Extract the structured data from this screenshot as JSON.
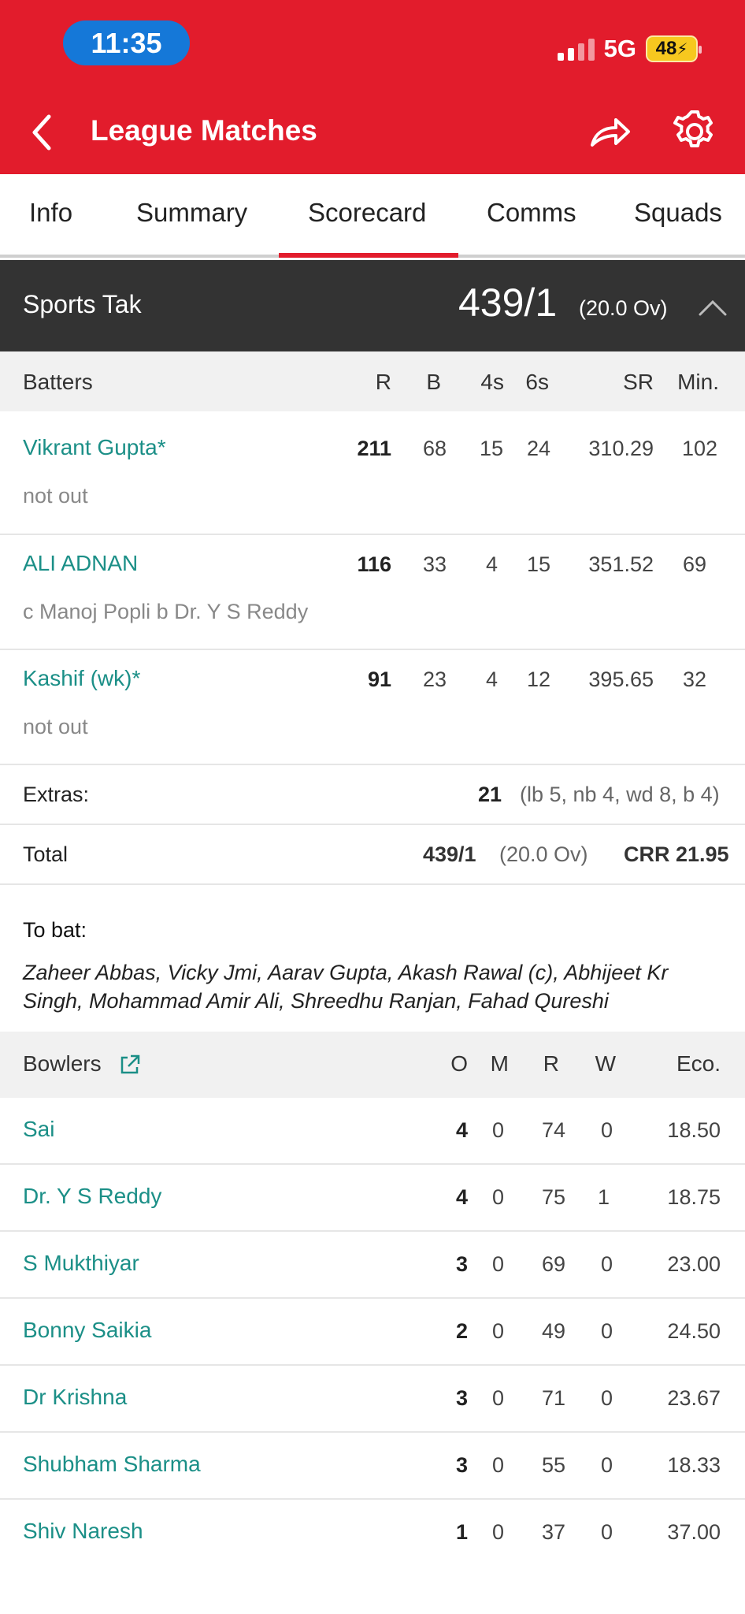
{
  "status_bar": {
    "time": "11:35",
    "network": "5G",
    "battery": "48"
  },
  "header": {
    "title": "League Matches"
  },
  "tabs": [
    "Info",
    "Summary",
    "Scorecard",
    "Comms",
    "Squads"
  ],
  "active_tab": "Scorecard",
  "innings": {
    "team": "Sports Tak",
    "score": "439/1",
    "overs": "(20.0 Ov)"
  },
  "batting": {
    "headers": {
      "name": "Batters",
      "r": "R",
      "b": "B",
      "fours": "4s",
      "sixes": "6s",
      "sr": "SR",
      "min": "Min."
    },
    "rows": [
      {
        "name": "Vikrant Gupta*",
        "dismissal": "not out",
        "r": "211",
        "b": "68",
        "fours": "15",
        "sixes": "24",
        "sr": "310.29",
        "min": "102"
      },
      {
        "name": "ALI ADNAN",
        "dismissal": "c Manoj Popli b Dr. Y S Reddy",
        "r": "116",
        "b": "33",
        "fours": "4",
        "sixes": "15",
        "sr": "351.52",
        "min": "69"
      },
      {
        "name": "Kashif  (wk)*",
        "dismissal": "not out",
        "r": "91",
        "b": "23",
        "fours": "4",
        "sixes": "12",
        "sr": "395.65",
        "min": "32"
      }
    ],
    "extras": {
      "label": "Extras:",
      "value": "21",
      "detail": "(lb 5, nb 4, wd 8, b 4)"
    },
    "total": {
      "label": "Total",
      "score": "439/1",
      "overs": "(20.0 Ov)",
      "crr": "CRR 21.95"
    },
    "to_bat": {
      "label": "To bat:",
      "players": "Zaheer Abbas, Vicky Jmi, Aarav Gupta, Akash Rawal (c), Abhijeet Kr Singh, Mohammad Amir Ali, Shreedhu Ranjan, Fahad Qureshi"
    }
  },
  "bowling": {
    "headers": {
      "name": "Bowlers",
      "o": "O",
      "m": "M",
      "r": "R",
      "w": "W",
      "eco": "Eco."
    },
    "rows": [
      {
        "name": "Sai",
        "o": "4",
        "m": "0",
        "r": "74",
        "w": "0",
        "eco": "18.50"
      },
      {
        "name": "Dr. Y S Reddy",
        "o": "4",
        "m": "0",
        "r": "75",
        "w": "1",
        "eco": "18.75"
      },
      {
        "name": "S Mukthiyar",
        "o": "3",
        "m": "0",
        "r": "69",
        "w": "0",
        "eco": "23.00"
      },
      {
        "name": "Bonny Saikia",
        "o": "2",
        "m": "0",
        "r": "49",
        "w": "0",
        "eco": "24.50"
      },
      {
        "name": "Dr Krishna",
        "o": "3",
        "m": "0",
        "r": "71",
        "w": "0",
        "eco": "23.67"
      },
      {
        "name": "Shubham Sharma",
        "o": "3",
        "m": "0",
        "r": "55",
        "w": "0",
        "eco": "18.33"
      },
      {
        "name": "Shiv Naresh",
        "o": "1",
        "m": "0",
        "r": "37",
        "w": "0",
        "eco": "37.00"
      }
    ]
  },
  "colors": {
    "header_red": "#e21c2c",
    "player_teal": "#1b8f87",
    "team_bar": "#333333",
    "time_pill_blue": "#1578d8"
  }
}
